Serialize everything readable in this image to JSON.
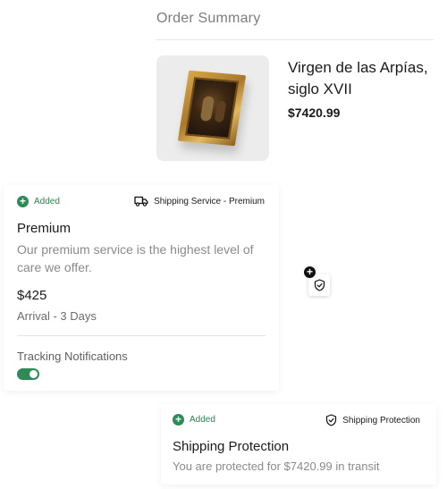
{
  "order": {
    "title": "Order Summary",
    "product": {
      "name": "Virgen de las Arpías, siglo XVII",
      "price": "$7420.99"
    }
  },
  "premium": {
    "status": "Added",
    "service_label": "Shipping Service - Premium",
    "tier": "Premium",
    "description": "Our premium service is the highest level of care we offer.",
    "price": "$425",
    "arrival": "Arrival - 3 Days",
    "tracking_label": "Tracking Notifications",
    "tracking_enabled": true
  },
  "protection": {
    "status": "Added",
    "service_label": "Shipping Protection",
    "title": "Shipping Protection",
    "description": "You are protected for $7420.99 in transit"
  },
  "colors": {
    "accent_green": "#2e8a56",
    "muted_text": "#8a8a8a"
  },
  "icons": {
    "truck": "truck-icon",
    "shield": "shield-check-icon",
    "plus": "plus-circle-icon"
  }
}
